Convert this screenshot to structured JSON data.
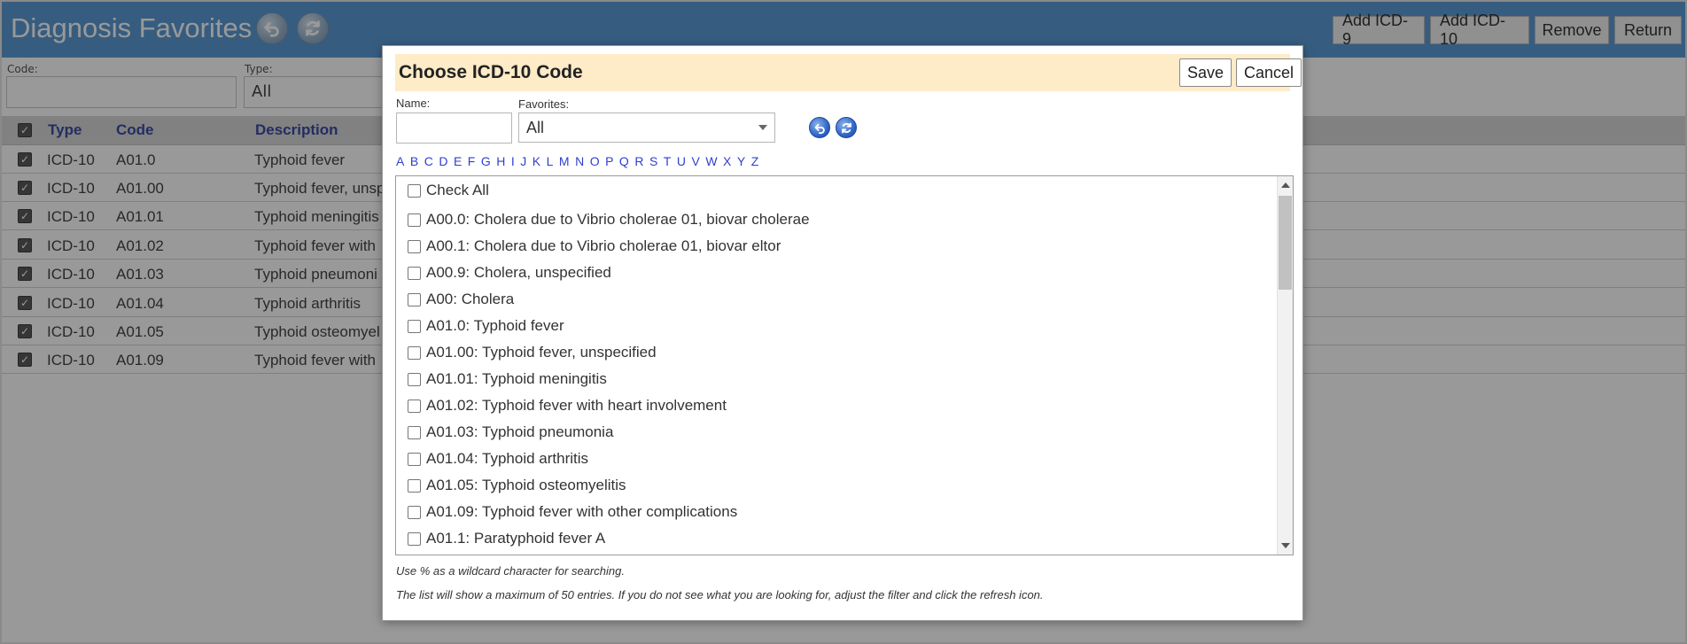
{
  "app": {
    "title": "Diagnosis Favorites",
    "header_buttons": [
      "Add ICD-9",
      "Add ICD-10",
      "Remove",
      "Return"
    ],
    "icons": {
      "back": "undo-icon",
      "refresh": "refresh-icon"
    }
  },
  "filters": {
    "code_label": "Code:",
    "code_value": "",
    "type_label": "Type:",
    "type_value": "All"
  },
  "table": {
    "columns": [
      "Type",
      "Code",
      "Description"
    ],
    "rows": [
      {
        "type": "ICD-10",
        "code": "A01.0",
        "desc": "Typhoid fever"
      },
      {
        "type": "ICD-10",
        "code": "A01.00",
        "desc": "Typhoid fever, unsp"
      },
      {
        "type": "ICD-10",
        "code": "A01.01",
        "desc": "Typhoid meningitis"
      },
      {
        "type": "ICD-10",
        "code": "A01.02",
        "desc": "Typhoid fever with"
      },
      {
        "type": "ICD-10",
        "code": "A01.03",
        "desc": "Typhoid pneumoni"
      },
      {
        "type": "ICD-10",
        "code": "A01.04",
        "desc": "Typhoid arthritis"
      },
      {
        "type": "ICD-10",
        "code": "A01.05",
        "desc": "Typhoid osteomyel"
      },
      {
        "type": "ICD-10",
        "code": "A01.09",
        "desc": "Typhoid fever with"
      }
    ]
  },
  "modal": {
    "title": "Choose ICD-10 Code",
    "save_label": "Save",
    "cancel_label": "Cancel",
    "name_label": "Name:",
    "name_value": "",
    "favorites_label": "Favorites:",
    "favorites_value": "All",
    "alphabet": [
      "A",
      "B",
      "C",
      "D",
      "E",
      "F",
      "G",
      "H",
      "I",
      "J",
      "K",
      "L",
      "M",
      "N",
      "O",
      "P",
      "Q",
      "R",
      "S",
      "T",
      "U",
      "V",
      "W",
      "X",
      "Y",
      "Z"
    ],
    "check_all_label": "Check All",
    "items": [
      "A00.0: Cholera due to Vibrio cholerae 01, biovar cholerae",
      "A00.1: Cholera due to Vibrio cholerae 01, biovar eltor",
      "A00.9: Cholera, unspecified",
      "A00: Cholera",
      "A01.0: Typhoid fever",
      "A01.00: Typhoid fever, unspecified",
      "A01.01: Typhoid meningitis",
      "A01.02: Typhoid fever with heart involvement",
      "A01.03: Typhoid pneumonia",
      "A01.04: Typhoid arthritis",
      "A01.05: Typhoid osteomyelitis",
      "A01.09: Typhoid fever with other complications",
      "A01.1: Paratyphoid fever A"
    ],
    "note_wildcard": "Use % as a wildcard character for searching.",
    "note_max": "The list will show a maximum of 50 entries. If you do not see what you are looking for, adjust the filter and click the refresh icon."
  },
  "colors": {
    "header_bg": "#5b9bd5",
    "modal_header_bg": "#feebc8",
    "link_blue": "#2f3fd0",
    "column_header_text": "#3b4ba3"
  }
}
